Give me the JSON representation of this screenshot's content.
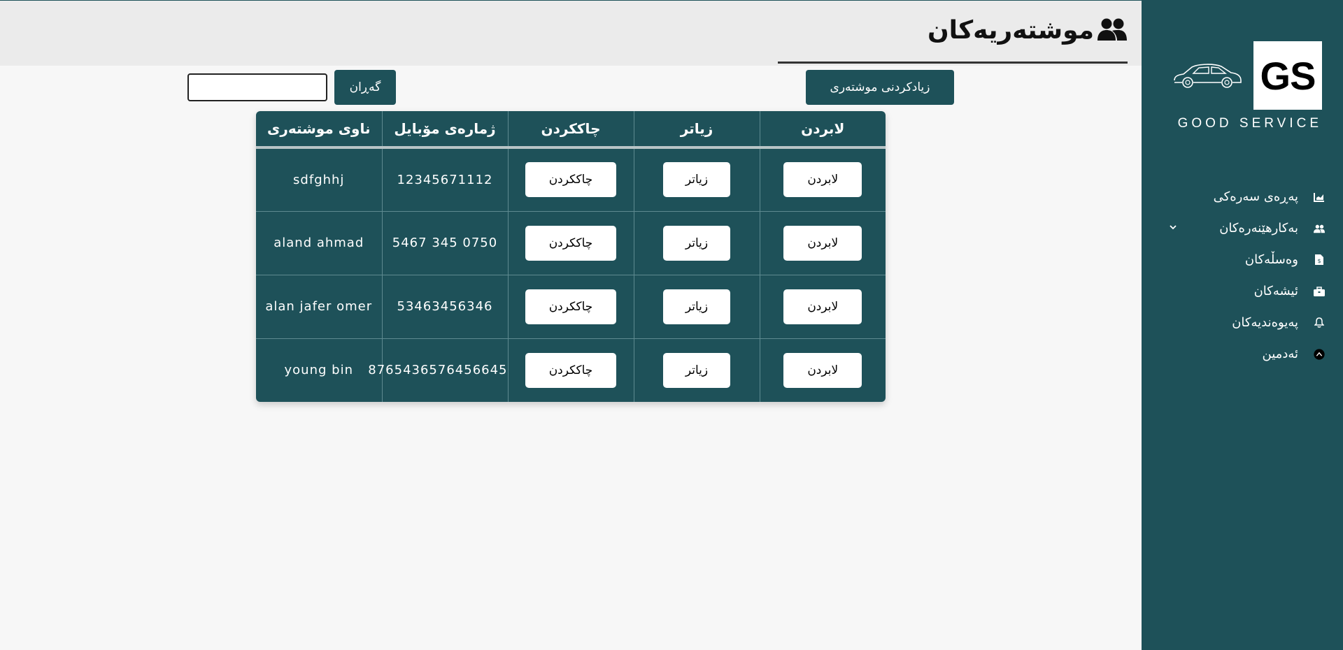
{
  "header": {
    "title": "موشتەریەکان",
    "title_icon": "users-icon"
  },
  "toolbar": {
    "add_customer_label": "زیادکردنی موشتەری",
    "search_label": "گەڕان",
    "search_value": ""
  },
  "sidebar": {
    "brand_logo": "GS",
    "brand_name": "GOOD SERVICE",
    "items": [
      {
        "label": "پەڕەی سەرەکی",
        "icon": "chart-icon"
      },
      {
        "label": "بەکارهێنەرەکان",
        "icon": "users-icon",
        "has_dropdown": true
      },
      {
        "label": "وەسڵەکان",
        "icon": "file-dollar-icon"
      },
      {
        "label": "ئیشەکان",
        "icon": "toolbox-icon"
      },
      {
        "label": "پەیوەندیەکان",
        "icon": "bell-icon"
      },
      {
        "label": "ئەدمین",
        "icon": "admin-circle-icon"
      }
    ]
  },
  "table": {
    "headers": [
      "لابردن",
      "زیاتر",
      "چاککردن",
      "ژمارەی مۆبایل",
      "ناوی موشتەری"
    ],
    "rows": [
      {
        "delete_label": "لابردن",
        "more_label": "زیاتر",
        "edit_label": "چاککردن",
        "phone": "12345671112",
        "name": "sdfghhj"
      },
      {
        "delete_label": "لابردن",
        "more_label": "زیاتر",
        "edit_label": "چاککردن",
        "phone": "0750 345 5467",
        "name": "aland ahmad"
      },
      {
        "delete_label": "لابردن",
        "more_label": "زیاتر",
        "edit_label": "چاککردن",
        "phone": "53463456346",
        "name": "alan jafer omer"
      },
      {
        "delete_label": "لابردن",
        "more_label": "زیاتر",
        "edit_label": "چاککردن",
        "phone": "876543657645664‭5",
        "name": "young bin"
      }
    ]
  },
  "colors": {
    "primary": "#1e5159",
    "header_bg": "#ebebeb",
    "page_bg": "#f7f7f7"
  }
}
